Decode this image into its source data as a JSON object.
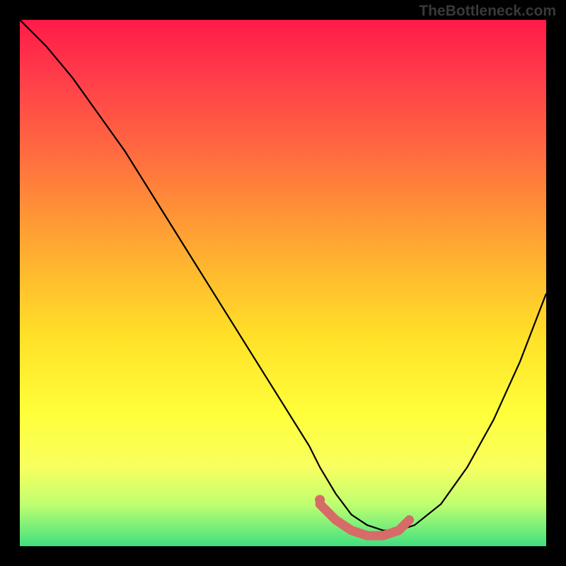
{
  "watermark": "TheBottleneck.com",
  "chart_data": {
    "type": "line",
    "title": "",
    "xlabel": "",
    "ylabel": "",
    "xlim": [
      0,
      100
    ],
    "ylim": [
      0,
      100
    ],
    "series": [
      {
        "name": "bottleneck-curve",
        "x": [
          0,
          5,
          10,
          15,
          20,
          25,
          30,
          35,
          40,
          45,
          50,
          55,
          57,
          60,
          63,
          66,
          69,
          72,
          75,
          80,
          85,
          90,
          95,
          100
        ],
        "values": [
          100,
          95,
          89,
          82,
          75,
          67,
          59,
          51,
          43,
          35,
          27,
          19,
          15,
          10,
          6,
          4,
          3,
          3,
          4,
          8,
          15,
          24,
          35,
          48
        ]
      }
    ],
    "highlight": {
      "name": "optimal-range",
      "color": "#d66b68",
      "x": [
        57,
        60,
        63,
        66,
        69,
        72,
        74
      ],
      "values": [
        8,
        5,
        3,
        2,
        2,
        3,
        5
      ]
    },
    "background_gradient": {
      "stops": [
        {
          "pos": 0,
          "color": "#ff1a48"
        },
        {
          "pos": 10,
          "color": "#ff3a4a"
        },
        {
          "pos": 25,
          "color": "#ff6a40"
        },
        {
          "pos": 45,
          "color": "#ffb030"
        },
        {
          "pos": 60,
          "color": "#ffe028"
        },
        {
          "pos": 75,
          "color": "#ffff3a"
        },
        {
          "pos": 85,
          "color": "#f8ff60"
        },
        {
          "pos": 92,
          "color": "#c0ff70"
        },
        {
          "pos": 100,
          "color": "#40e080"
        }
      ]
    }
  }
}
